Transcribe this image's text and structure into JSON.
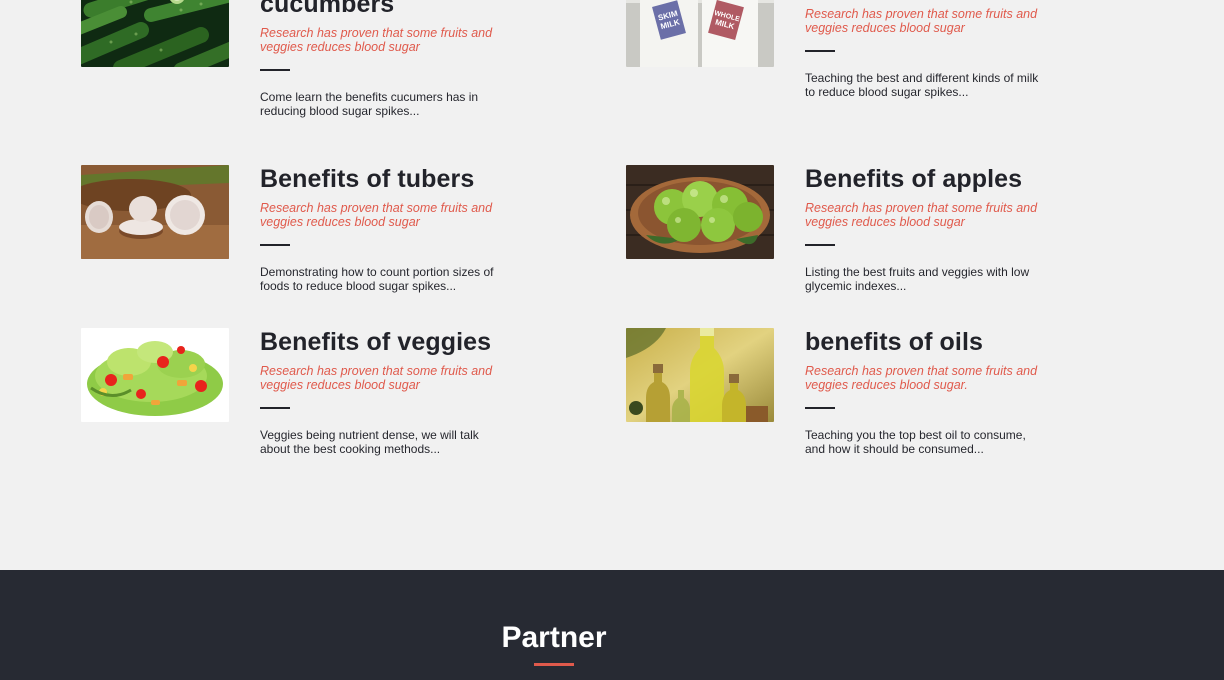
{
  "articles": [
    {
      "title": "cucumbers",
      "subtitle": "Research has proven that some fruits and veggies reduces blood sugar",
      "description": "Come learn the benefits cucumers has in reducing blood sugar spikes...",
      "image": "cucumbers-image"
    },
    {
      "title": "",
      "subtitle": "Research has proven that some fruits and veggies reduces blood sugar",
      "description": "Teaching the best and different kinds of milk to reduce blood sugar spikes...",
      "image": "milk-image",
      "image_labels": [
        "SKIM MILK",
        "WHOLE MILK"
      ]
    },
    {
      "title": "Benefits of tubers",
      "subtitle": "Research has proven that some fruits and veggies reduces blood sugar",
      "description": "Demonstrating how to count portion sizes of foods to reduce blood sugar spikes...",
      "image": "tubers-image"
    },
    {
      "title": "Benefits of apples",
      "subtitle": "Research has proven that some fruits and veggies reduces blood sugar",
      "description": "Listing the best fruits and veggies with low glycemic indexes...",
      "image": "apples-image"
    },
    {
      "title": "Benefits of veggies",
      "subtitle": "Research has proven that some fruits and veggies reduces blood sugar",
      "description": "Veggies being nutrient dense, we will talk about the best cooking methods...",
      "image": "salad-image"
    },
    {
      "title": "benefits of oils",
      "subtitle": "Research has proven that some fruits and veggies reduces blood sugar.",
      "description": "Teaching you the top best oil to consume, and how it should be consumed...",
      "image": "oils-image"
    }
  ],
  "footer": {
    "title": "Partner"
  },
  "colors": {
    "accent": "#e05a4c",
    "dark": "#272a33",
    "background": "#f1f1f1"
  }
}
